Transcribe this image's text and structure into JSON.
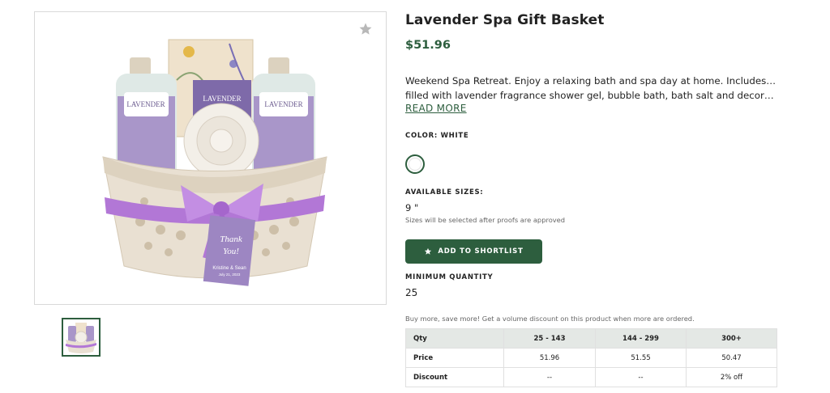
{
  "product": {
    "title": "Lavender Spa Gift Basket",
    "price": "$51.96",
    "description_line1": "Weekend Spa Retreat. Enjoy a relaxing bath and spa day at home. Includes a basket",
    "description_line2": "filled with lavender fragrance shower gel, bubble bath, bath salt and decorative bat...",
    "read_more": "READ MORE",
    "bottle_label": "LAVENDER",
    "tag_text_1": "Thank",
    "tag_text_2": "You!",
    "tag_names": "Kristine & Sean",
    "tag_date": "July 21, 2023"
  },
  "color": {
    "label": "COLOR: WHITE",
    "selected_hex": "#ffffff"
  },
  "sizes": {
    "label": "AVAILABLE SIZES:",
    "value": "9 \"",
    "note": "Sizes will be selected after proofs are approved"
  },
  "actions": {
    "shortlist_label": "ADD TO SHORTLIST",
    "shortlist_icon": "star-icon",
    "favorite_icon": "star-icon"
  },
  "minimum": {
    "label": "MINIMUM QUANTITY",
    "value": "25"
  },
  "pricing": {
    "note": "Buy more, save more! Get a volume discount on this product when more are ordered.",
    "headers": [
      "Qty",
      "25 - 143",
      "144 - 299",
      "300+"
    ],
    "rows": [
      {
        "label": "Price",
        "values": [
          "51.96",
          "51.55",
          "50.47"
        ]
      },
      {
        "label": "Discount",
        "values": [
          "--",
          "--",
          "2% off"
        ]
      }
    ]
  },
  "theme": {
    "accent": "#2d5e3e",
    "ribbon": "#b277d6",
    "basket": "#e9e0d2"
  }
}
